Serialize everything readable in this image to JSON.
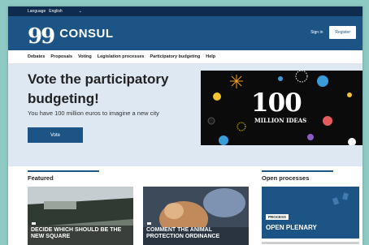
{
  "top_bar": {
    "language_label": "Language",
    "language_value": "English"
  },
  "header": {
    "logo_mark": "99",
    "logo_text": "CONSUL",
    "signin_label": "Sign in",
    "register_label": "Register"
  },
  "nav": {
    "items": [
      "Debates",
      "Proposals",
      "Voting",
      "Legislation processes",
      "Participatory budgeting",
      "Help"
    ]
  },
  "hero": {
    "title": "Vote the participatory budgeting!",
    "subtitle": "You have 100 million euros to imagine a new city",
    "vote_label": "Vote",
    "banner_number": "100",
    "banner_caption": "MILLION IDEAS"
  },
  "featured": {
    "title": "Featured",
    "cards": [
      {
        "title": "DECIDE WHICH SHOULD BE THE NEW SQUARE"
      },
      {
        "title": "COMMENT THE ANIMAL PROTECTION ORDINANCE"
      }
    ]
  },
  "open_processes": {
    "title": "Open processes",
    "badge": "PROCESS",
    "process_title": "OPEN PLENARY"
  },
  "colors": {
    "brand": "#1c5585",
    "topbar": "#0f2b4d",
    "hero_bg": "#dde8f2"
  }
}
